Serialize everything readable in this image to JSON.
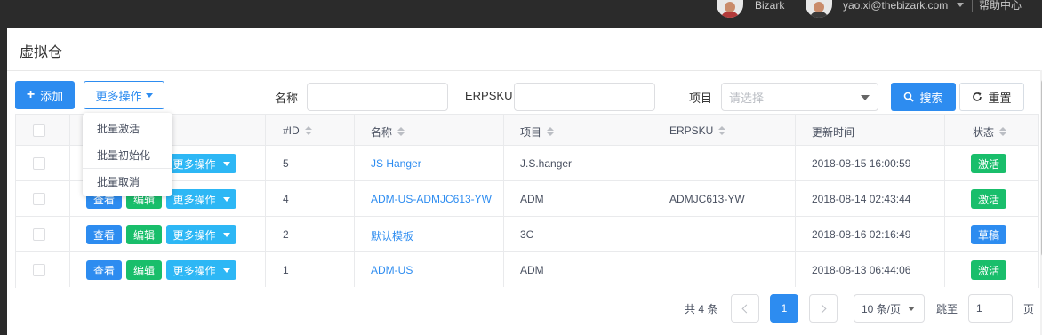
{
  "topbar": {
    "company": "Bizark",
    "user_email": "yao.xi@thebizark.com",
    "help": "帮助中心"
  },
  "page": {
    "title": "虚拟仓"
  },
  "toolbar": {
    "add_label": "添加",
    "batch_label": "更多操作",
    "name_label": "名称",
    "name_value": "",
    "erpsku_label": "ERPSKU",
    "erpsku_value": "",
    "project_label": "项目",
    "project_placeholder": "请选择",
    "search_label": "搜索",
    "reset_label": "重置"
  },
  "batch_menu": {
    "items": [
      "批量激活",
      "批量初始化",
      "批量取消"
    ]
  },
  "table": {
    "columns": [
      "#ID",
      "名称",
      "项目",
      "ERPSKU",
      "更新时间",
      "状态"
    ],
    "action_labels": {
      "view": "查看",
      "edit": "编辑",
      "more": "更多操作"
    },
    "rows": [
      {
        "id": "5",
        "name": "JS Hanger",
        "project": "J.S.hanger",
        "erpsku": "",
        "updated": "2018-08-15 16:00:59",
        "status": "激活"
      },
      {
        "id": "4",
        "name": "ADM-US-ADMJC613-YW",
        "project": "ADM",
        "erpsku": "ADMJC613-YW",
        "updated": "2018-08-14 02:43:44",
        "status": "激活"
      },
      {
        "id": "2",
        "name": "默认模板",
        "project": "3C",
        "erpsku": "",
        "updated": "2018-08-16 02:16:49",
        "status": "草稿"
      },
      {
        "id": "1",
        "name": "ADM-US",
        "project": "ADM",
        "erpsku": "",
        "updated": "2018-08-13 06:44:06",
        "status": "激活"
      }
    ]
  },
  "status_colors": {
    "激活": "#19be6b",
    "草稿": "#2d8cf0"
  },
  "pager": {
    "total": "共 4 条",
    "current": "1",
    "page_size": "10 条/页",
    "jump_label": "跳至",
    "jump_value": "1",
    "page_unit": "页"
  }
}
